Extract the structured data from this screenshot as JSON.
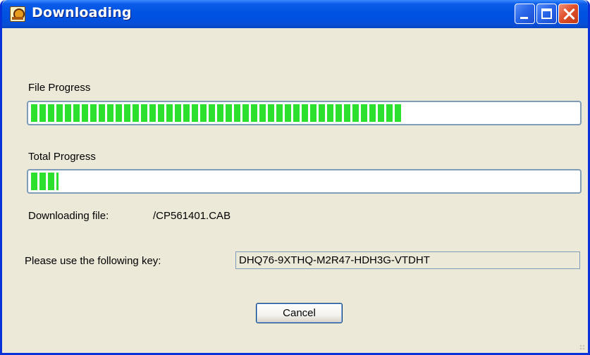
{
  "window": {
    "title": "Downloading"
  },
  "file_progress": {
    "label": "File Progress",
    "fraction": 0.68
  },
  "total_progress": {
    "label": "Total Progress",
    "fraction": 0.05
  },
  "downloading": {
    "label": "Downloading file:",
    "filename": "/CP561401.CAB"
  },
  "key": {
    "label": "Please use the following key:",
    "value": "DHQ76-9XTHQ-M2R47-HDH3G-VTDHT"
  },
  "buttons": {
    "cancel": "Cancel"
  },
  "colors": {
    "progress_fill": "#2de02d",
    "title_bar": "#0053e1",
    "window_bg": "#ece9d8",
    "border": "#7f9db9"
  }
}
